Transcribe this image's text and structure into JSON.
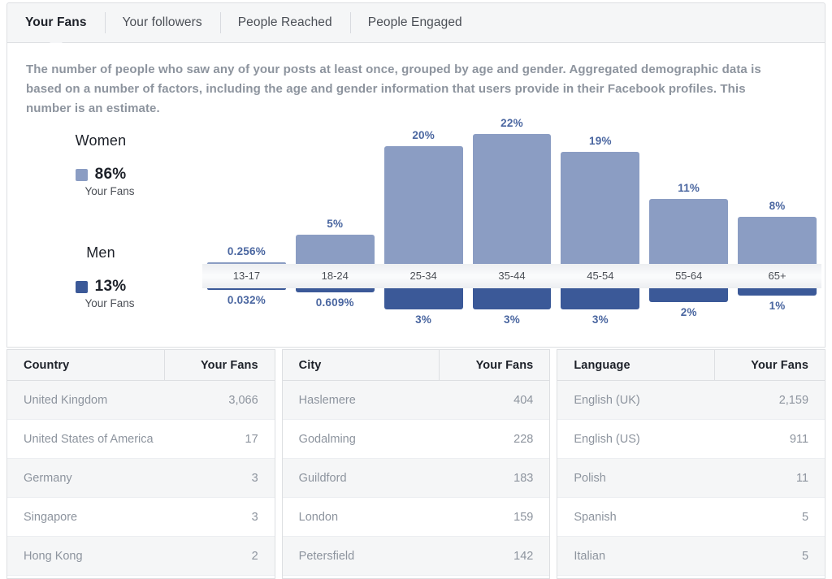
{
  "tabs": [
    {
      "label": "Your Fans",
      "active": true
    },
    {
      "label": "Your followers",
      "active": false
    },
    {
      "label": "People Reached",
      "active": false
    },
    {
      "label": "People Engaged",
      "active": false
    }
  ],
  "description": "The number of people who saw any of your posts at least once, grouped by age and gender. Aggregated demographic data is based on a number of factors, including the age and gender information that users provide in their Facebook profiles. This number is an estimate.",
  "legend": {
    "women": {
      "title": "Women",
      "percent": "86%",
      "sub": "Your Fans",
      "color": "#8b9dc3"
    },
    "men": {
      "title": "Men",
      "percent": "13%",
      "sub": "Your Fans",
      "color": "#3b5998"
    }
  },
  "chart_data": {
    "type": "bar",
    "title": "Your Fans by age and gender",
    "xlabel": "",
    "ylabel": "",
    "grid": false,
    "legend_position": "left",
    "categories": [
      "13-17",
      "18-24",
      "25-34",
      "35-44",
      "45-54",
      "55-64",
      "65+"
    ],
    "series": [
      {
        "name": "Women",
        "color": "#8b9dc3",
        "values": [
          0.256,
          5,
          20,
          22,
          19,
          11,
          8
        ],
        "labels": [
          "0.256%",
          "5%",
          "20%",
          "22%",
          "19%",
          "11%",
          "8%"
        ]
      },
      {
        "name": "Men",
        "color": "#3b5998",
        "values": [
          0.032,
          0.609,
          3,
          3,
          3,
          2,
          1
        ],
        "labels": [
          "0.032%",
          "0.609%",
          "3%",
          "3%",
          "3%",
          "2%",
          "1%"
        ]
      }
    ],
    "ylim": [
      0,
      24
    ]
  },
  "tables": [
    {
      "name_header": "Country",
      "value_header": "Your Fans",
      "rows": [
        {
          "name": "United Kingdom",
          "value": "3,066"
        },
        {
          "name": "United States of America",
          "value": "17"
        },
        {
          "name": "Germany",
          "value": "3"
        },
        {
          "name": "Singapore",
          "value": "3"
        },
        {
          "name": "Hong Kong",
          "value": "2"
        }
      ]
    },
    {
      "name_header": "City",
      "value_header": "Your Fans",
      "rows": [
        {
          "name": "Haslemere",
          "value": "404"
        },
        {
          "name": "Godalming",
          "value": "228"
        },
        {
          "name": "Guildford",
          "value": "183"
        },
        {
          "name": "London",
          "value": "159"
        },
        {
          "name": "Petersfield",
          "value": "142"
        }
      ]
    },
    {
      "name_header": "Language",
      "value_header": "Your Fans",
      "rows": [
        {
          "name": "English (UK)",
          "value": "2,159"
        },
        {
          "name": "English (US)",
          "value": "911"
        },
        {
          "name": "Polish",
          "value": "11"
        },
        {
          "name": "Spanish",
          "value": "5"
        },
        {
          "name": "Italian",
          "value": "5"
        }
      ]
    }
  ]
}
